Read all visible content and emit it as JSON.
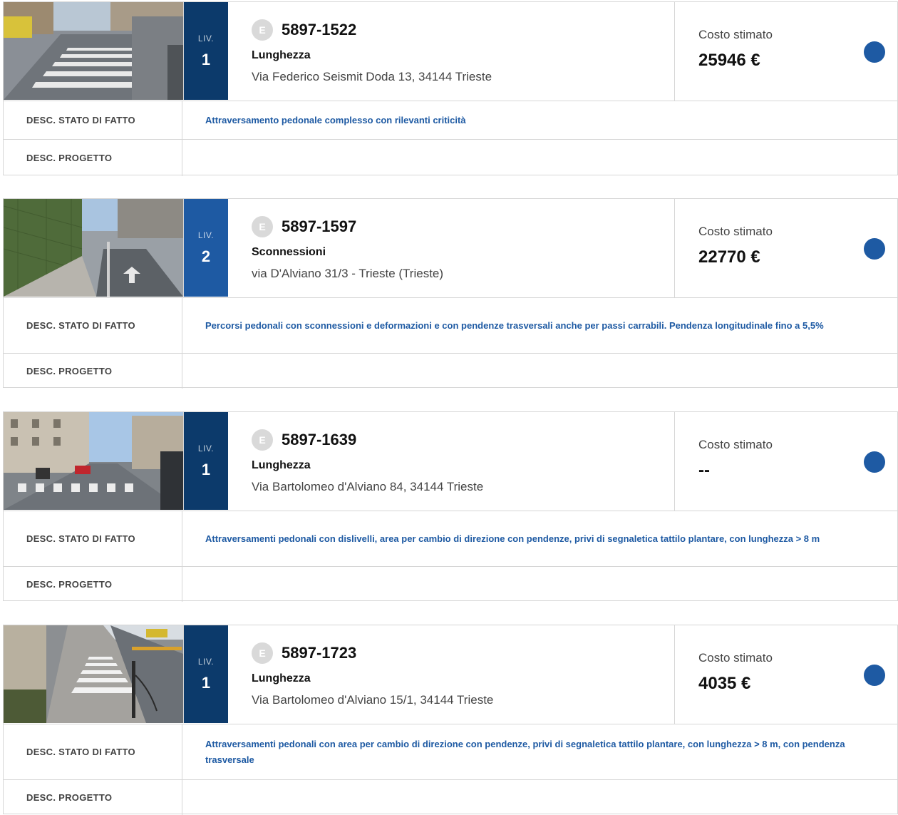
{
  "labels": {
    "level_prefix": "LIV.",
    "badge": "E",
    "cost_label": "Costo stimato",
    "desc_state": "DESC. STATO DI FATTO",
    "desc_project": "DESC. PROGETTO"
  },
  "cards": [
    {
      "level": "1",
      "code": "5897-1522",
      "type": "Lunghezza",
      "address": "Via Federico Seismit Doda 13, 34144 Trieste",
      "cost": "25946 €",
      "desc_state": "Attraversamento pedonale complesso con rilevanti criticità",
      "desc_project": ""
    },
    {
      "level": "2",
      "code": "5897-1597",
      "type": "Sconnessioni",
      "address": "via D'Alviano 31/3 - Trieste (Trieste)",
      "cost": "22770 €",
      "desc_state": "Percorsi pedonali con sconnessioni e deformazioni e con pendenze trasversali anche per passi carrabili. Pendenza longitudinale fino a 5,5%",
      "desc_project": ""
    },
    {
      "level": "1",
      "code": "5897-1639",
      "type": "Lunghezza",
      "address": "Via Bartolomeo d'Alviano 84, 34144 Trieste",
      "cost": "--",
      "desc_state": "Attraversamenti pedonali con dislivelli, area per cambio di direzione con pendenze, privi di segnaletica tattilo plantare, con lunghezza > 8 m",
      "desc_project": ""
    },
    {
      "level": "1",
      "code": "5897-1723",
      "type": "Lunghezza",
      "address": "Via Bartolomeo d'Alviano 15/1, 34144 Trieste",
      "cost": "4035 €",
      "desc_state": "Attraversamenti pedonali con area per cambio di direzione con pendenze, privi di segnaletica tattilo plantare, con lunghezza > 8 m, con pendenza trasversale",
      "desc_project": ""
    }
  ],
  "colors": {
    "level1": "#0c3a6b",
    "level2": "#1e5aa3",
    "status_dot": "#1e5aa3",
    "desc_text": "#1e5aa3"
  }
}
